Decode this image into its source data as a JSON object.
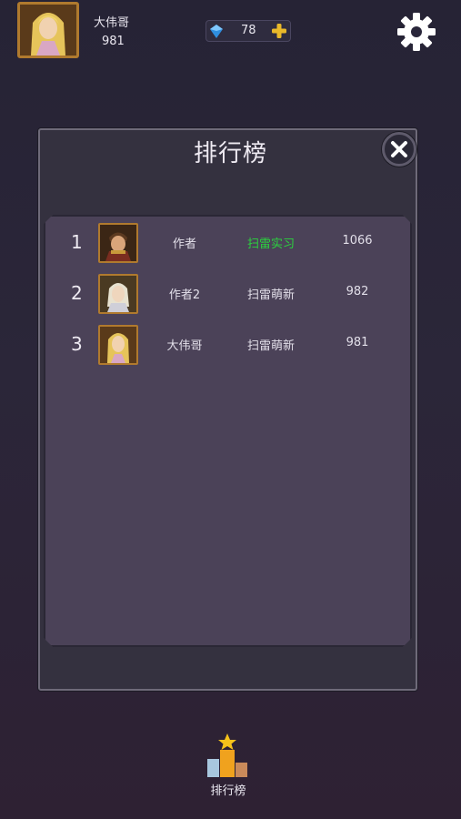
{
  "player": {
    "name": "大伟哥",
    "score": "981"
  },
  "currency": {
    "gems": "78"
  },
  "icons": {
    "gem": "blue-gem-icon",
    "plus": "plus-icon",
    "settings": "gear-icon",
    "close": "close-icon",
    "leaderboard": "podium-star-icon"
  },
  "leaderboard": {
    "title": "排行榜",
    "rows": [
      {
        "rank": "1",
        "name": "作者",
        "title": "扫雷实习",
        "score": "1066",
        "title_color": "#2bd23e"
      },
      {
        "rank": "2",
        "name": "作者2",
        "title": "扫雷萌新",
        "score": "982",
        "title_color": "#e2dfe9"
      },
      {
        "rank": "3",
        "name": "大伟哥",
        "title": "扫雷萌新",
        "score": "981",
        "title_color": "#e2dfe9"
      }
    ]
  },
  "bottom_nav": {
    "leaderboard_label": "排行榜"
  },
  "colors": {
    "accent_gold": "#b07a2e",
    "highlight_green": "#2bd23e",
    "panel_bg": "#4b4258"
  }
}
